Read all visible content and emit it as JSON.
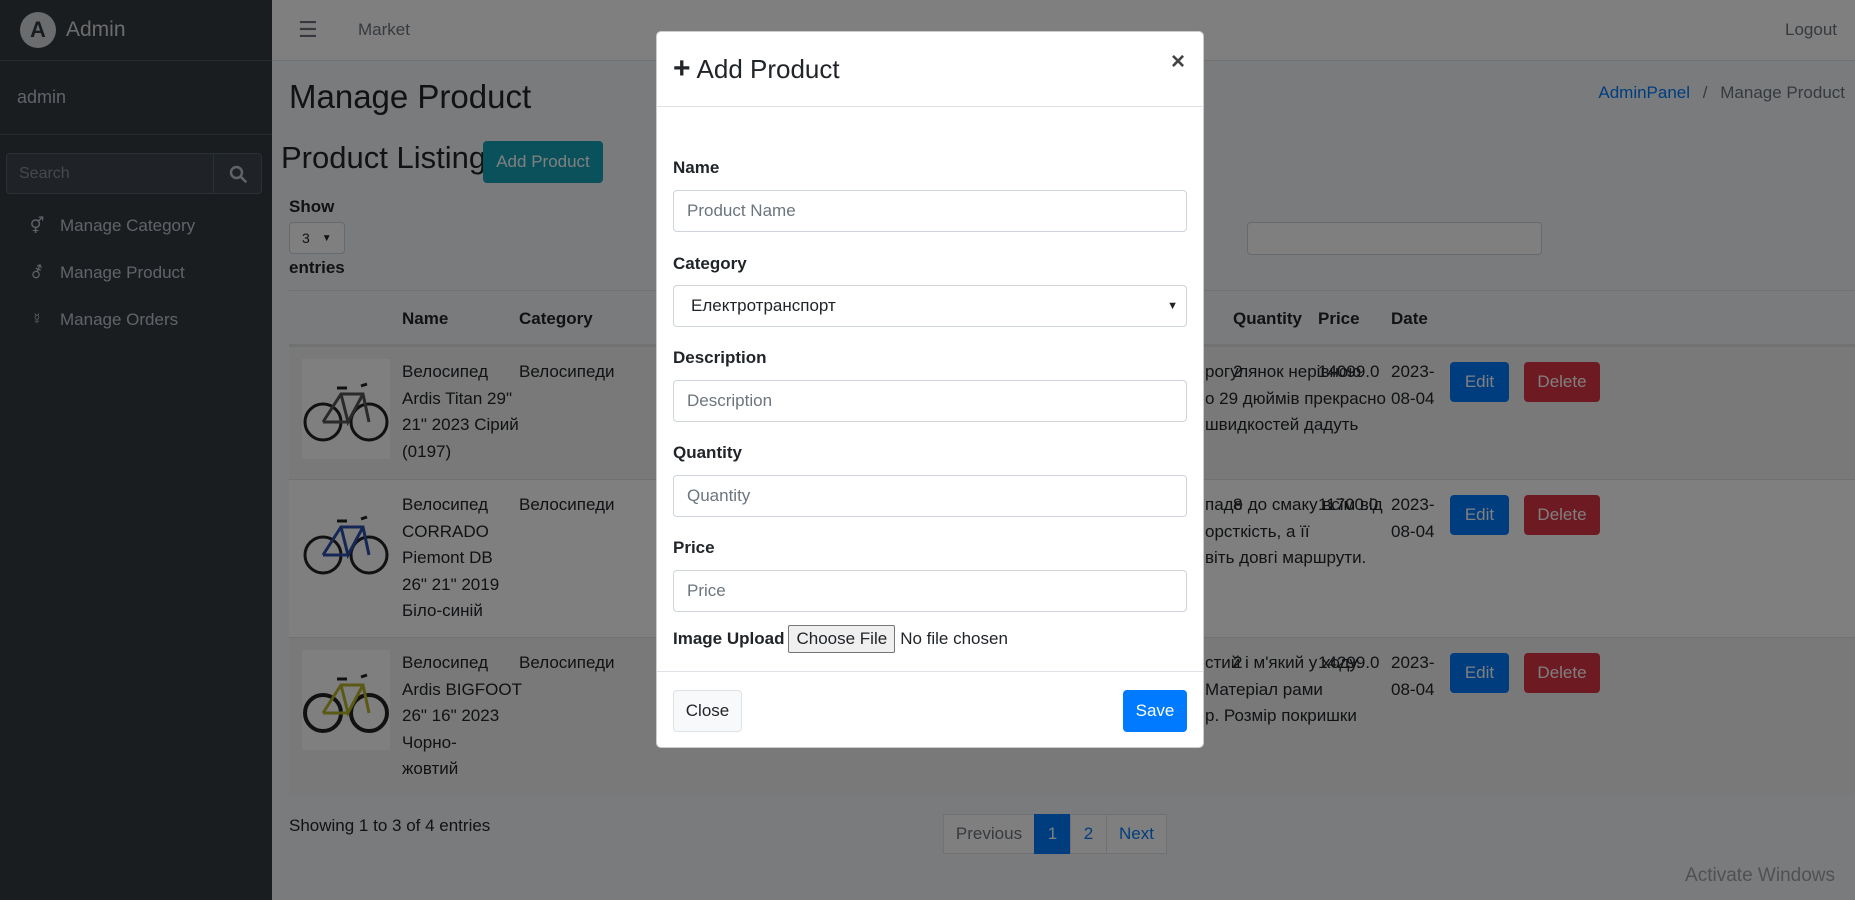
{
  "sidebar": {
    "brand": "Admin",
    "brand_logo": "A",
    "user": "admin",
    "search_placeholder": "Search",
    "items": [
      {
        "label": "Manage Category",
        "icon": "venus-mars-icon"
      },
      {
        "label": "Manage Product",
        "icon": "mars-stroke-icon"
      },
      {
        "label": "Manage Orders",
        "icon": "mercury-icon"
      }
    ]
  },
  "topbar": {
    "market": "Market",
    "logout": "Logout"
  },
  "page": {
    "title": "Manage Product",
    "breadcrumb": [
      "AdminPanel",
      "/",
      "Manage Product"
    ],
    "listing_title": "Product Listing",
    "add_button": "Add Product",
    "show": "Show",
    "entries_value": "3",
    "entries": "entries"
  },
  "table": {
    "headers": [
      "Name",
      "Category",
      "Quantity",
      "Price",
      "Date"
    ],
    "rows": [
      {
        "name": [
          "Велосипед",
          "Ardis Titan 29\"",
          "21\" 2023 Сірий",
          "(0197)"
        ],
        "category": "Велосипеди",
        "desc": [
          "рогулянок нерівною",
          "о 29 дюймів прекрасно",
          "швидкостей дадуть"
        ],
        "quantity": "2",
        "price": "14099.0",
        "date": [
          "2023-",
          "08-04"
        ],
        "edit": "Edit",
        "delete": "Delete"
      },
      {
        "name": [
          "Велосипед",
          "CORRADO",
          "Piemont DB",
          "26\" 21\" 2019",
          "Біло-синій"
        ],
        "category": "Велосипеди",
        "desc": [
          "паде до смаку всім від",
          "орсткість, а її",
          "віть довгі маршрути."
        ],
        "quantity": "8",
        "price": "11700.0",
        "date": [
          "2023-",
          "08-04"
        ],
        "edit": "Edit",
        "delete": "Delete"
      },
      {
        "name": [
          "Велосипед",
          "Ardis BIGFOOT",
          "26\" 16\" 2023",
          "Чорно-",
          "жовтий"
        ],
        "category": "Велосипеди",
        "desc": [
          "стий і м'який у ходу.",
          "Матеріал рами",
          "р. Розмір покришки"
        ],
        "quantity": "2",
        "price": "14299.0",
        "date": [
          "2023-",
          "08-04"
        ],
        "edit": "Edit",
        "delete": "Delete"
      }
    ]
  },
  "footer": {
    "showing": "Showing 1 to 3 of 4 entries",
    "pagination": [
      "Previous",
      "1",
      "2",
      "Next"
    ],
    "watermark": "Activate Windows"
  },
  "modal": {
    "title": "Add Product",
    "close_symbol": "×",
    "fields": {
      "name_label": "Name",
      "name_placeholder": "Product Name",
      "category_label": "Category",
      "category_value": "Електротранспорт",
      "description_label": "Description",
      "description_placeholder": "Description",
      "quantity_label": "Quantity",
      "quantity_placeholder": "Quantity",
      "price_label": "Price",
      "price_placeholder": "Price",
      "image_label": "Image Upload",
      "choose_file": "Choose File",
      "no_file": "No file chosen"
    },
    "close_button": "Close",
    "save_button": "Save"
  },
  "colors": {
    "sidebar_bg": "#343a40",
    "primary": "#007bff",
    "info": "#17a2b8",
    "danger": "#dc3545",
    "backdrop": "rgba(0,0,0,0.5)"
  }
}
